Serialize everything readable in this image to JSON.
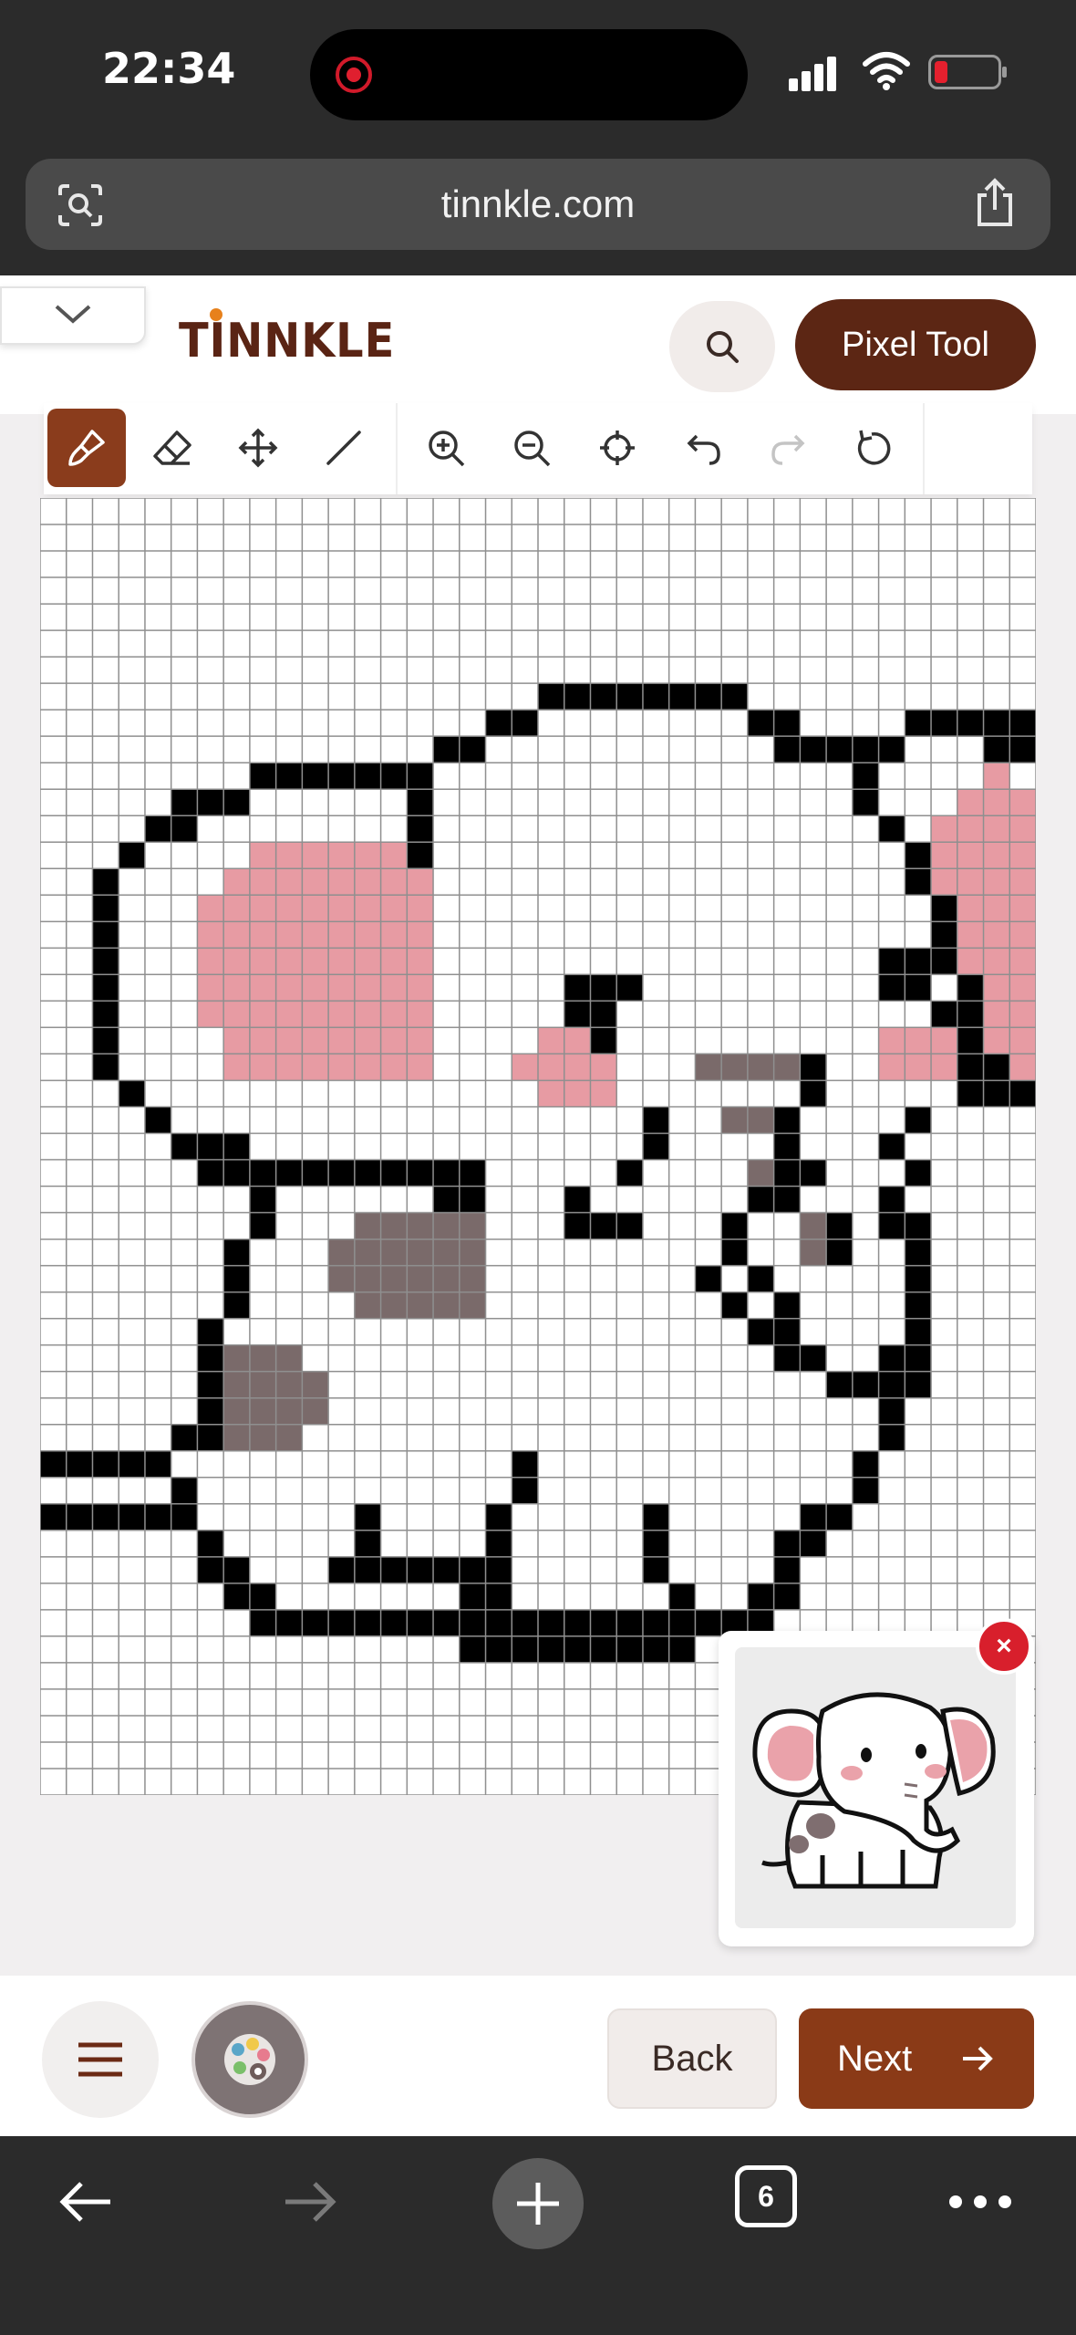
{
  "status_bar": {
    "time": "22:34"
  },
  "browser": {
    "url": "tinnkle.com",
    "open_tabs": "6"
  },
  "header": {
    "logo": "TINNKLE",
    "pixel_tool_label": "Pixel Tool"
  },
  "toolbar": {
    "tools": [
      "brush-icon",
      "eraser-icon",
      "move-icon",
      "line-icon",
      "zoom-in-icon",
      "zoom-out-icon",
      "center-icon",
      "undo-icon",
      "redo-icon",
      "reset-icon"
    ],
    "active_tool": "brush-icon"
  },
  "reference": {
    "close_label": "×"
  },
  "footer": {
    "back_label": "Back",
    "next_label": "Next"
  },
  "colors": {
    "brand": "#5c2614",
    "accent": "#8a3a17",
    "pink": "#e79ba3",
    "gray": "#7a6a6a",
    "outline": "#000000"
  },
  "canvas": {
    "cols": 38,
    "rows": 49,
    "pixel_art": [
      "......................................",
      "......................................",
      "......................................",
      "......................................",
      "......................................",
      "......................................",
      "......................................",
      "...................KKKKKKKK...........",
      ".................KKWWWWWWWWKK....KKKKK",
      "...............KKWWWWWWWWWWWKKKKKWWWKK",
      "........KKKKKKKWWWWWWWWWWWWWWWWKWWWWPW",
      ".....KKKWWWWWWKWWWWWWWWWWWWWWWWKWWWPPP",
      "....KKWWWWWWWWKWWWWWWWWWWWWWWWWWKWPPPP",
      "...KWWWWPPPPPPKWWWWWWWWWWWWWWWWWWKPPPP",
      "..KWWWWPPPPPPPPWWWWWWWWWWWWWWWWWWKPPPP",
      "..KWWWPPPPPPPPPWWWWWWWWWWWWWWWWWWWKPPP",
      "..KWWWPPPPPPPPPWWWWWWWWWWWWWWWWWWWKPPP",
      "..KWWWPPPPPPPPPWWWWWWWWWWWWWWWWWKKKPPP",
      "..KWWWPPPPPPPPPWWWWWKKKWWWWWWWWWKKWKPP",
      "..KWWWPPPPPPPPPWWWWWKKWWWWWWWWWWWWKKPP",
      "..KWWWWPPPPPPPPWWWWPPKWWWWWWWWWWPPPKPP",
      "..KWWWWPPPPPPPPWWWPPPPWWWGGGGKWWPPPKKP",
      "...KWWWWWWWWWWWWWWWPPPWWWWWWWKWWWWWKKK",
      "....KWWWWWWWWWWWWWWWWWWKWWGGKWWWWKWWWW",
      ".....KKKWWWWWWWWWWWWWWWKWWWWKWWWKWWWWW",
      "......KKKKKKKKKKKWWWWWKWWWWGKKWWWKWWWWW",
      "........KWWWWWWKKWWWKWWWWWWKKWWWKWWWWW",
      "........KWWWGGGGGWWWKKKWWWKWWGKWKKWWWWW",
      ".......KWWWGGGGGGWWWWWWWWWKWWGKWWKWWWWW",
      ".......KWWWGGGGGGWWWWWWWWKWKWWWWWKWWWWW",
      ".......KWWWWGGGGGWWWWWWWWWKWKWWWWKWWWWW",
      "......KWWWWWWWWWWWWWWWWWWWWKKWWWWKWWWWW",
      "......KGGGWWWWWWWWWWWWWWWWWWKKWWKKWWWWW",
      "......KGGGGWWWWWWWWWWWWWWWWWWWKKKKWWWWW",
      "......KGGGGWWWWWWWWWWWWWWWWWWWWWKWWWWWW",
      ".....KKGGGWWWWWWWWWWWWWWWWWWWWWWKWWWWWW",
      "KKKKKWWWWWWWWWWWWWKWWWWWWWWWWWWKWWWWWWW",
      ".....KWWWWWWWWWWWWKWWWWWWWWWWWWKWWWWWWW",
      "KKKKKKWWWWWWKWWWWKWWWWWKWWWWWKKWWWWWWW",
      "......KWWWWWKWWWWKWWWWWKWWWWKKWWWWWWWW",
      "......KKWWWKKKKKKKWWWWWKWWWWKWWWWWWWWW",
      ".......KKWWWWWWWKKWWWWWWKWWKKWWWWWWWWW",
      "........KKKKKKKKKKKKKKKKKKKK..........",
      "................KKKKKKKKK.............",
      "......................................",
      "......................................",
      "......................................",
      "......................................",
      "......................................"
    ]
  }
}
